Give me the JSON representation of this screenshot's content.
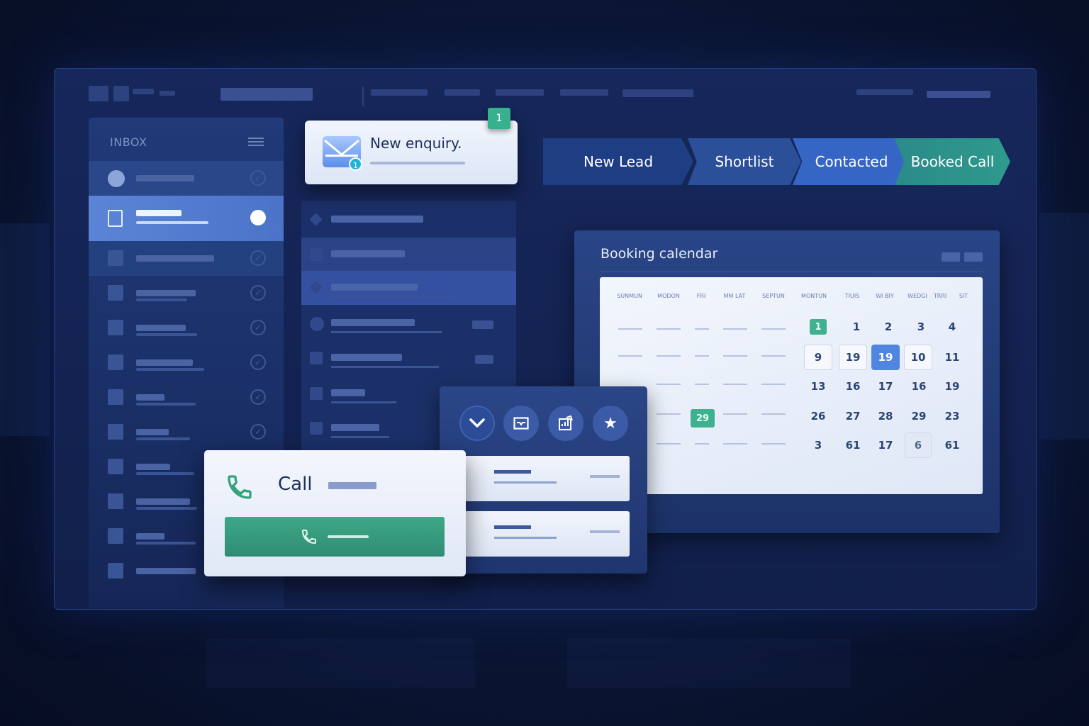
{
  "sidebar": {
    "title": "INBOX"
  },
  "enquiry": {
    "title": "New enquiry.",
    "unread_count": "1",
    "badge": "1"
  },
  "pipeline": {
    "stages": [
      "New Lead",
      "Shortlist",
      "Contacted",
      "Booked Call"
    ]
  },
  "calendar": {
    "title": "Booking calendar",
    "weekdays": [
      "SUNMUN",
      "MODON",
      "FRI",
      "MM LAT",
      "SEPTUN",
      "MONTUN",
      "TIUIS",
      "WI BIY",
      "WEDGI",
      "TRRI",
      "SIT"
    ],
    "rows": [
      [
        "1",
        "1",
        "2",
        "3",
        "4"
      ],
      [
        "9",
        "19",
        "19",
        "10",
        "11"
      ],
      [
        "13",
        "16",
        "17",
        "16",
        "19"
      ],
      [
        "26",
        "27",
        "28",
        "29",
        "23"
      ],
      [
        "3",
        "61",
        "17",
        "6",
        "61"
      ]
    ],
    "left_highlight": "29",
    "today": "19"
  },
  "call": {
    "title": "Call"
  },
  "actions": {
    "icons": [
      "chevron-down-icon",
      "inbox-icon",
      "chart-icon",
      "star-icon"
    ]
  },
  "colors": {
    "accent_blue": "#4f86e0",
    "accent_green": "#3fb18f",
    "background": "#0c1839"
  }
}
